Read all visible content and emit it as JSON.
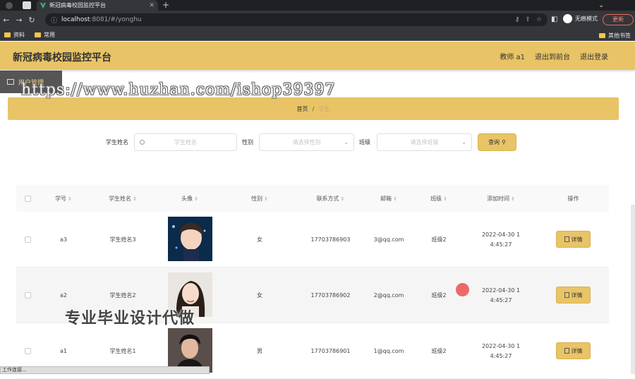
{
  "browser": {
    "tab_title": "新冠病毒校园监控平台",
    "url_host": "localhost",
    "url_path": ":8081/#/yonghu",
    "incognito_label": "无痕模式",
    "update_label": "更新",
    "bookmarks": [
      "资料",
      "常用"
    ],
    "bookmarks_right": "其他书签"
  },
  "header": {
    "title": "新冠病毒校园监控平台",
    "user": "教师 a1",
    "link_front": "退出到前台",
    "link_logout": "退出登录"
  },
  "sidebar": {
    "item": "用户管理"
  },
  "breadcrumb": {
    "home": "首页",
    "sep": "/",
    "current": "学生"
  },
  "watermark": "https://www.huzhan.com/ishop39397",
  "watermark_bottom": "专业毕业设计代做",
  "search": {
    "name_label": "学生姓名",
    "name_placeholder": "学生姓名",
    "gender_label": "性别",
    "gender_placeholder": "请选择性别",
    "class_label": "班级",
    "class_placeholder": "请选择班级",
    "query_label": "查询"
  },
  "table": {
    "headers": [
      "学号",
      "学生姓名",
      "头像",
      "性别",
      "联系方式",
      "邮箱",
      "班级",
      "添加时间",
      "操作"
    ],
    "rows": [
      {
        "id": "a3",
        "name": "学生姓名3",
        "gender": "女",
        "phone": "17703786903",
        "email": "3@qq.com",
        "class": "班级2",
        "time_1": "2022-04-30 1",
        "time_2": "4:45:27",
        "action": "详情"
      },
      {
        "id": "a2",
        "name": "学生姓名2",
        "gender": "女",
        "phone": "17703786902",
        "email": "2@qq.com",
        "class": "班级2",
        "time_1": "2022-04-30 1",
        "time_2": "4:45:27",
        "action": "详情"
      },
      {
        "id": "a1",
        "name": "学生姓名1",
        "gender": "男",
        "phone": "17703786901",
        "email": "1@qq.com",
        "class": "班级2",
        "time_1": "2022-04-30 1",
        "time_2": "4:45:27",
        "action": "详情"
      }
    ]
  },
  "status_text": "工作连接..."
}
